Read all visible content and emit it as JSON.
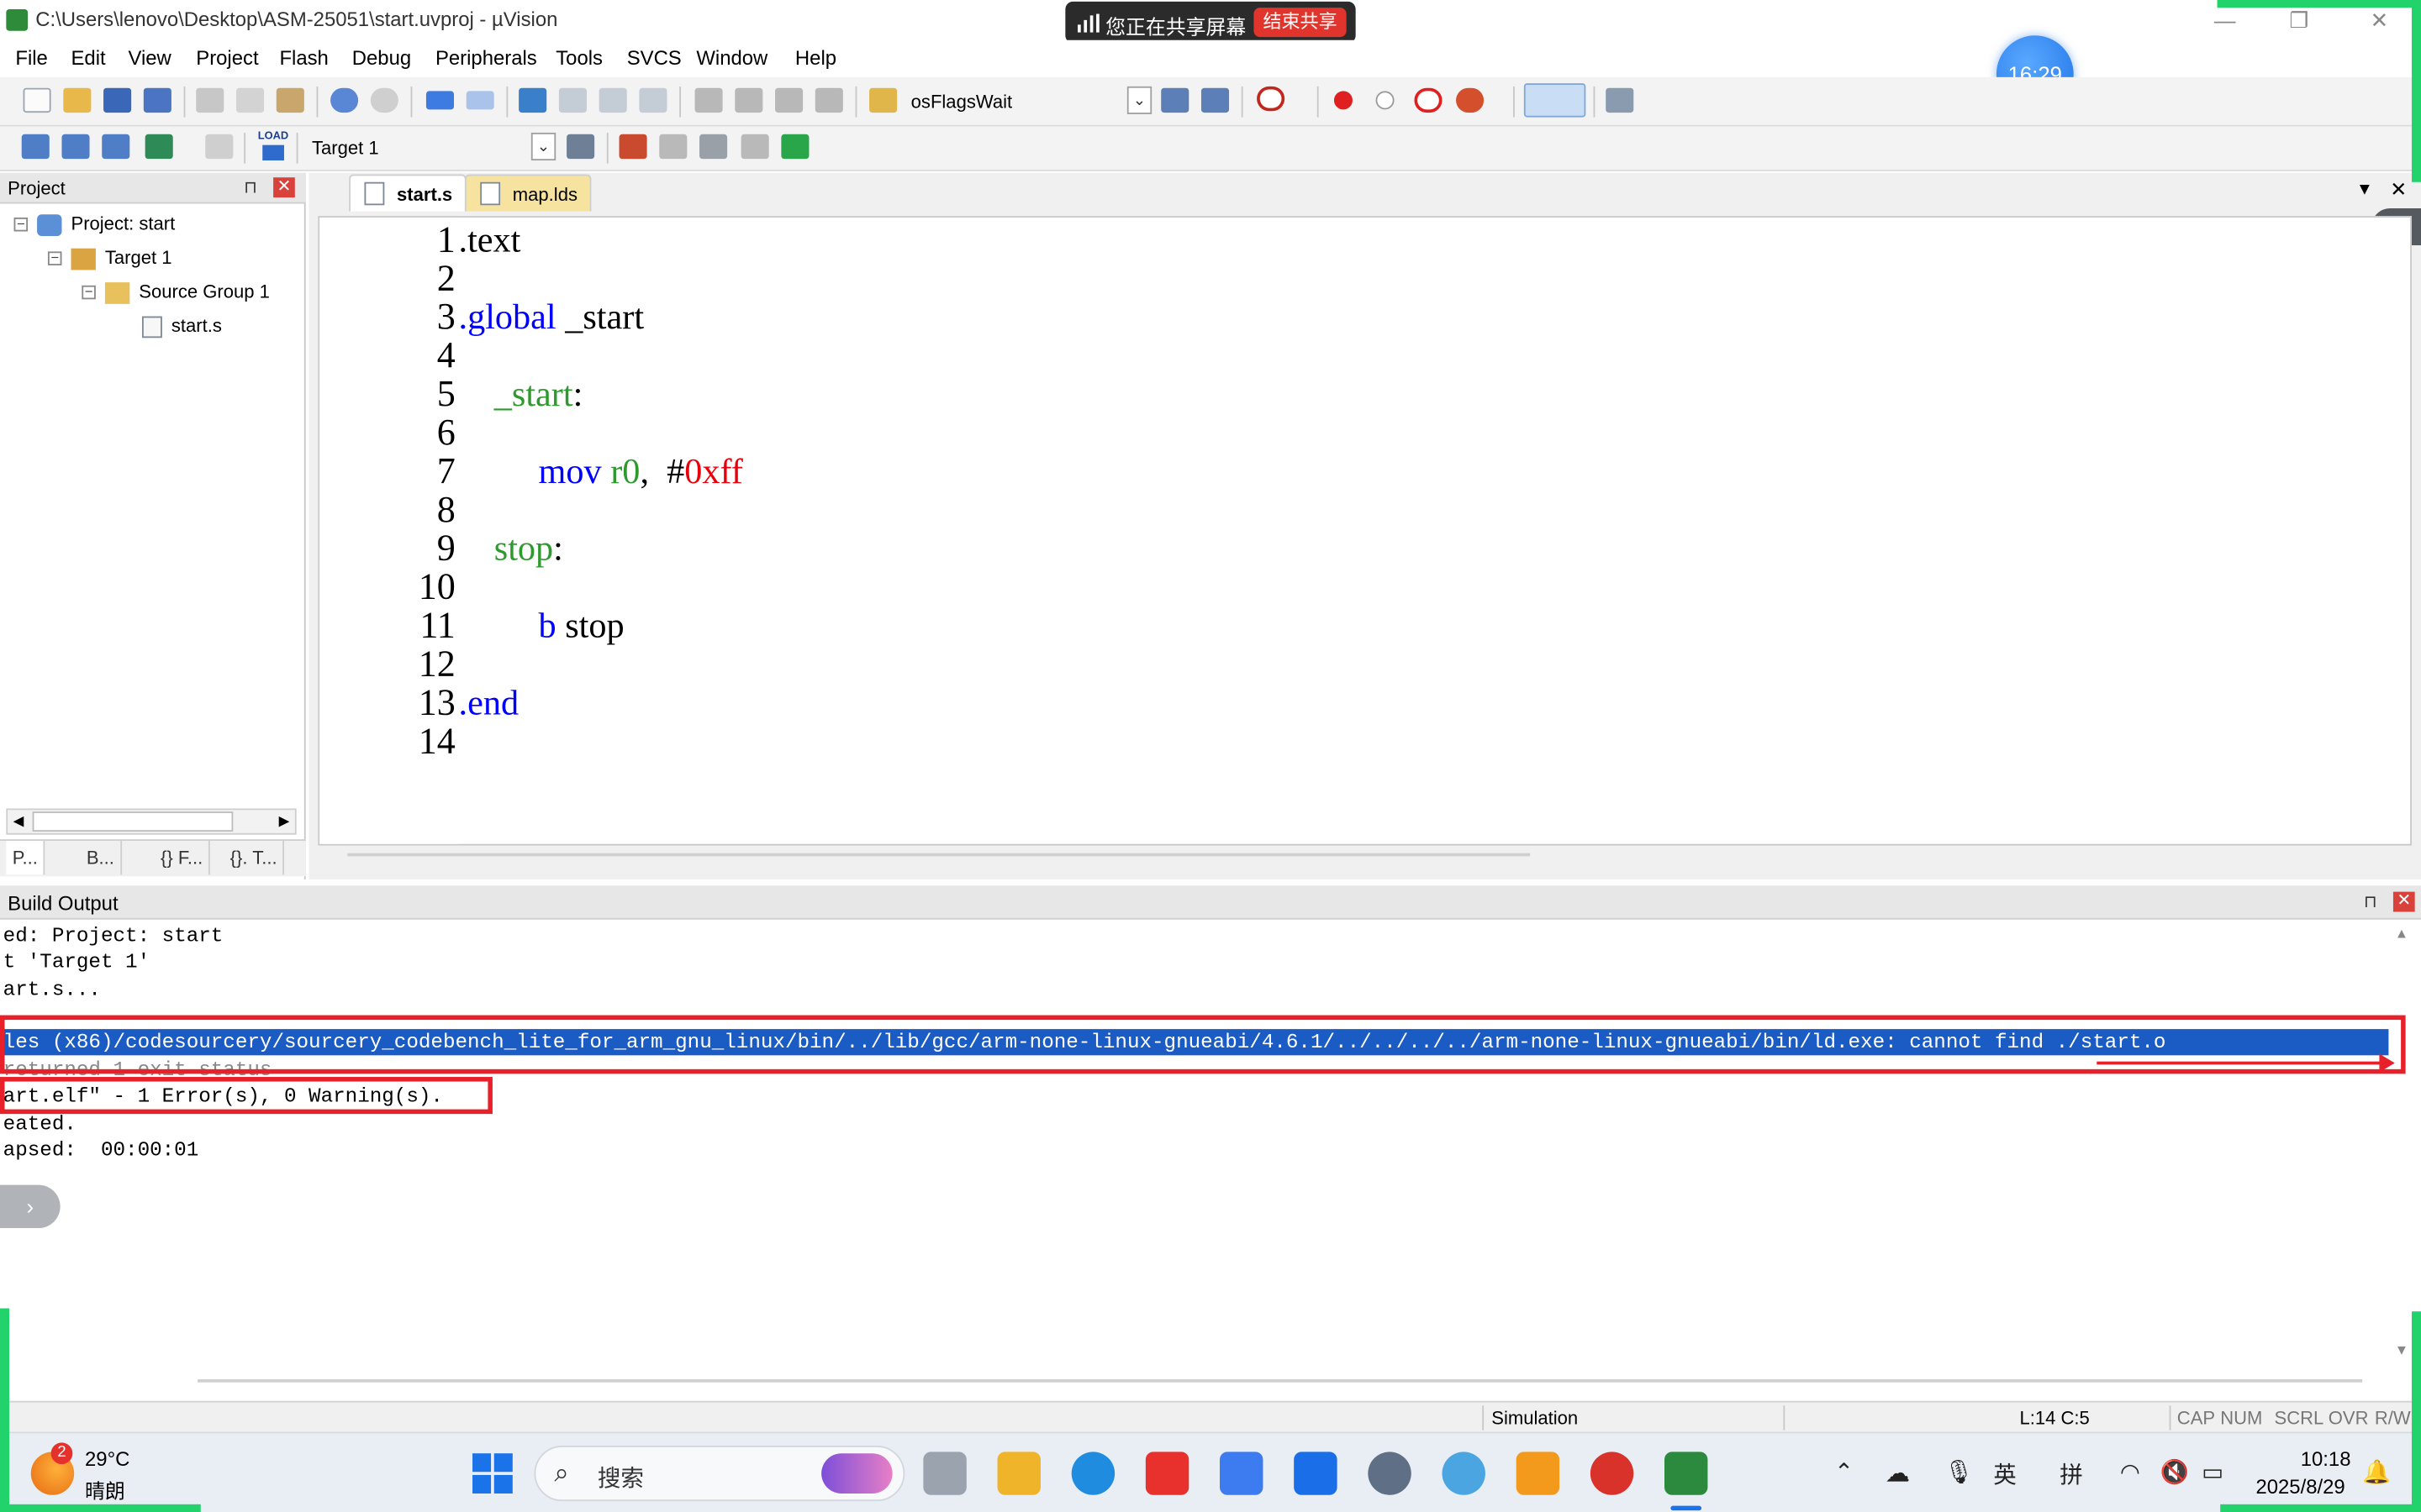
{
  "window": {
    "title": "C:\\Users\\lenovo\\Desktop\\ASM-25051\\start.uvproj - µVision",
    "minimize_glyph": "—",
    "restore_glyph": "❐",
    "close_glyph": "✕"
  },
  "share_banner": {
    "text": "您正在共享屏幕",
    "end_button": "结束共享"
  },
  "timer": {
    "value": "16:29"
  },
  "menu": [
    "File",
    "Edit",
    "View",
    "Project",
    "Flash",
    "Debug",
    "Peripherals",
    "Tools",
    "SVCS",
    "Window",
    "Help"
  ],
  "toolbar": {
    "find_combo": "osFlagsWait",
    "target_combo": "Target 1",
    "load_label": "LOAD"
  },
  "project_panel": {
    "title": "Project",
    "pin_glyph": "⊓",
    "close_glyph": "✕",
    "tree": [
      {
        "label": "Project: start",
        "expander": "−"
      },
      {
        "label": "Target 1",
        "expander": "−"
      },
      {
        "label": "Source Group 1",
        "expander": "−"
      },
      {
        "label": "start.s",
        "expander": ""
      }
    ],
    "tabs": [
      "P...",
      "B...",
      "{} F...",
      "{}.  T..."
    ]
  },
  "editor": {
    "tabs": [
      {
        "label": "start.s",
        "active": true
      },
      {
        "label": "map.lds",
        "active": false
      }
    ],
    "lines": [
      {
        "n": "1",
        "segs": [
          [
            ".text",
            "plain"
          ]
        ]
      },
      {
        "n": "2",
        "segs": []
      },
      {
        "n": "3",
        "segs": [
          [
            ".global",
            "dir"
          ],
          [
            " _start",
            "plain"
          ]
        ]
      },
      {
        "n": "4",
        "segs": []
      },
      {
        "n": "5",
        "segs": [
          [
            "    _start",
            "lbl"
          ],
          [
            ":",
            "plain"
          ]
        ]
      },
      {
        "n": "6",
        "segs": []
      },
      {
        "n": "7",
        "segs": [
          [
            "         mov",
            "op"
          ],
          [
            " r0",
            "reg"
          ],
          [
            ",  #",
            "plain"
          ],
          [
            "0xff",
            "num"
          ]
        ]
      },
      {
        "n": "8",
        "segs": []
      },
      {
        "n": "9",
        "segs": [
          [
            "    stop",
            "lbl"
          ],
          [
            ":",
            "plain"
          ]
        ]
      },
      {
        "n": "10",
        "segs": []
      },
      {
        "n": "11",
        "segs": [
          [
            "         b",
            "op"
          ],
          [
            " stop",
            "plain"
          ]
        ]
      },
      {
        "n": "12",
        "segs": []
      },
      {
        "n": "13",
        "segs": [
          [
            ".end",
            "dir"
          ]
        ]
      },
      {
        "n": "14",
        "segs": []
      }
    ]
  },
  "build_output": {
    "title": "Build Output",
    "lines": [
      "ed: Project: start",
      "t 'Target 1'",
      "art.s...",
      "",
      "les (x86)/codesourcery/sourcery_codebench_lite_for_arm_gnu_linux/bin/../lib/gcc/arm-none-linux-gnueabi/4.6.1/../../../../arm-none-linux-gnueabi/bin/ld.exe: cannot find ./start.o",
      "returned 1 exit status",
      "art.elf\" - 1 Error(s), 0 Warning(s).",
      "eated.",
      "apsed:  00:00:01"
    ]
  },
  "status_bar": {
    "mode": "Simulation",
    "position": "L:14 C:5",
    "flags": [
      "CAP",
      "NUM",
      "SCRL",
      "OVR",
      "R/W"
    ]
  },
  "taskbar": {
    "weather_badge": "2",
    "weather_temp": "29°C",
    "weather_desc": "晴朗",
    "search_placeholder": "搜索",
    "ime_lang": "英",
    "ime_mode": "拼",
    "time": "10:18",
    "date": "2025/8/29"
  },
  "colors": {
    "directive": "#0000ff",
    "label": "#2e9a2e",
    "number": "#e8000b",
    "selection": "#1b5bc4",
    "highlight_box": "#e8202a",
    "share_border": "#22d26a"
  }
}
